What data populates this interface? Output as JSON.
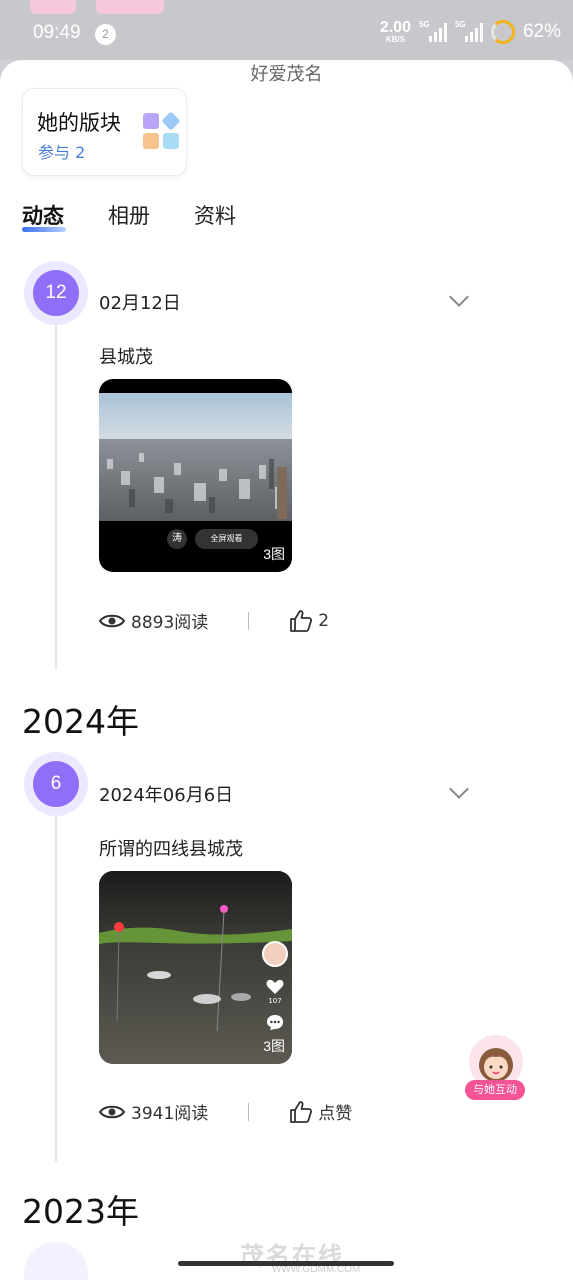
{
  "status_bar": {
    "time": "09:49",
    "notification_count": "2",
    "net_speed": "2.00",
    "net_unit": "KB/S",
    "signal_tag_1": "5G",
    "signal_tag_2": "5G",
    "battery": "62%",
    "battery_level": 0.62
  },
  "sheet": {
    "title": "好爱茂名"
  },
  "section": {
    "title": "她的版块",
    "participation": "参与 2"
  },
  "tabs": [
    "动态",
    "相册",
    "资料"
  ],
  "posts": [
    {
      "day": "12",
      "date": "02月12日",
      "text": "县城茂",
      "image_count": "3图",
      "overlay_btn_1": "涛",
      "overlay_btn_2": "全屏观看",
      "reads": "8893阅读",
      "likes": "2"
    },
    {
      "day": "6",
      "date": "2024年06月6日",
      "text": "所谓的四线县城茂",
      "image_count": "3图",
      "side_like_count": "107",
      "reads": "3941阅读",
      "likes": "点赞"
    }
  ],
  "years": [
    "2024年",
    "2023年"
  ],
  "fab": {
    "label": "与她互动"
  },
  "watermark": {
    "text": "茂名在线",
    "url": "WWW.GDMM.COM"
  },
  "colors": {
    "accent_purple": "#8f6ef8",
    "link_blue": "#4a7fd6",
    "fab_pink": "#f45394"
  }
}
